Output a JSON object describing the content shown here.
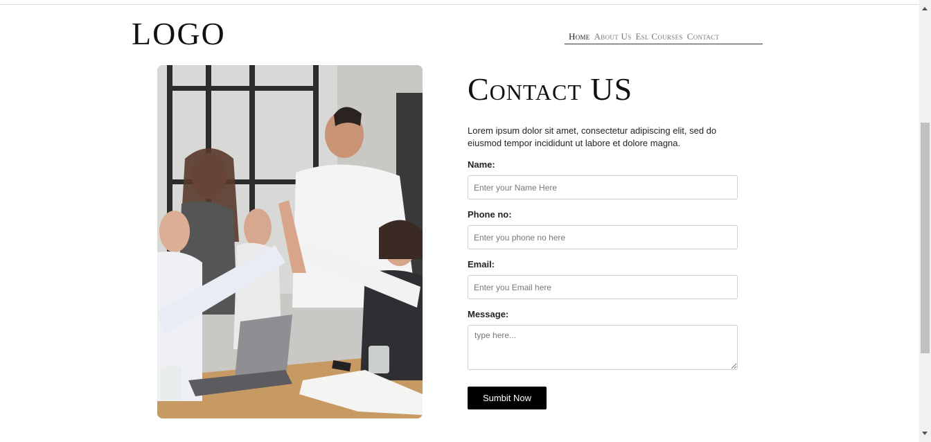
{
  "header": {
    "logo": "LOGO",
    "nav": [
      {
        "label": "Home",
        "active": true
      },
      {
        "label": "About Us",
        "active": false
      },
      {
        "label": "Esl Courses",
        "active": false
      },
      {
        "label": "Contact",
        "active": false
      }
    ]
  },
  "image": {
    "icon": "team-high-five-photo"
  },
  "contact": {
    "title": "Contact US",
    "intro": "Lorem ipsum dolor sit amet, consectetur adipiscing elit, sed do eiusmod tempor incididunt ut labore et dolore magna.",
    "fields": {
      "name": {
        "label": "Name:",
        "placeholder": "Enter your Name Here",
        "value": ""
      },
      "phone": {
        "label": "Phone no:",
        "placeholder": "Enter you phone no here",
        "value": ""
      },
      "email": {
        "label": "Email:",
        "placeholder": "Enter you Email here",
        "value": ""
      },
      "message": {
        "label": "Message:",
        "placeholder": "type here...",
        "value": ""
      }
    },
    "submit_label": "Sumbit Now"
  },
  "colors": {
    "accent": "#000000",
    "text": "#222222",
    "border": "#cfcfcf"
  }
}
